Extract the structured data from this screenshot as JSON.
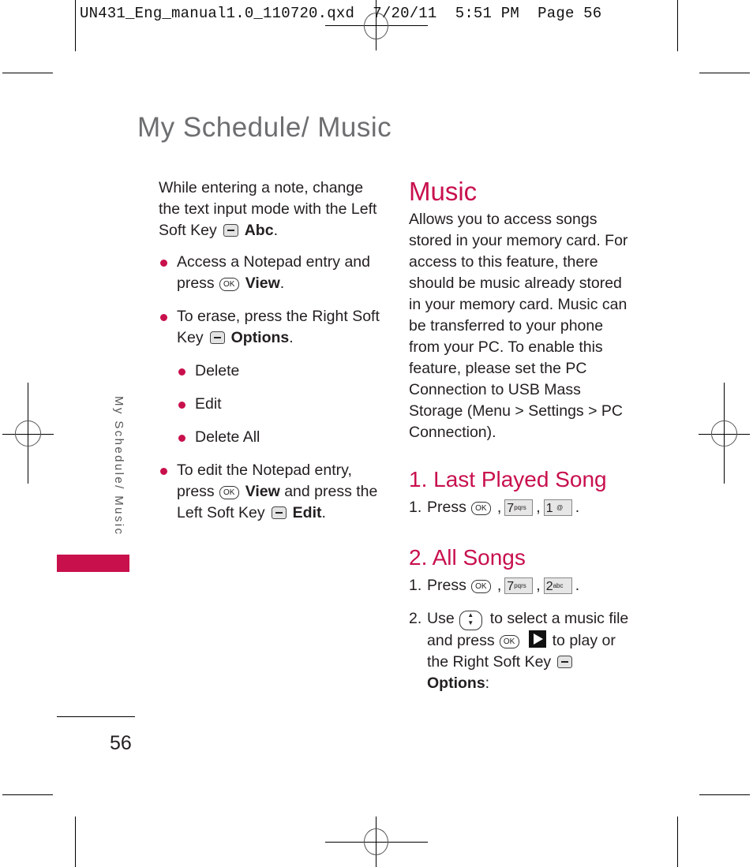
{
  "slug": {
    "filename": "UN431_Eng_manual1.0_110720.qxd",
    "date": "7/20/11",
    "time": "5:51 PM",
    "page_label": "Page 56"
  },
  "page_title": "My Schedule/ Music",
  "side_tab": {
    "label": "My Schedule/ Music",
    "accent_color": "#c8104c"
  },
  "folio": "56",
  "left_column": {
    "intro": {
      "text": "While entering a note, change the text input mode with the Left Soft Key",
      "key_icon": "soft-key-icon",
      "action": "Abc",
      "end": "."
    },
    "bullets": [
      {
        "text": "Access a Notepad entry and press",
        "key_icon": "ok-key-icon",
        "action": "View",
        "end": "."
      },
      {
        "text": "To erase, press the Right Soft Key",
        "key_icon": "soft-key-icon",
        "action": "Options",
        "end": "."
      }
    ],
    "sub_bullets": [
      "Delete",
      "Edit",
      "Delete All"
    ],
    "last_bullet": {
      "text1": "To edit the Notepad entry, press",
      "key1": "ok-key-icon",
      "action1": "View",
      "text2": "and press the Left Soft Key",
      "key2": "soft-key-icon",
      "action2": "Edit",
      "end": "."
    }
  },
  "right_column": {
    "heading": "Music",
    "description": "Allows you to access songs stored in your memory card. For access to this feature, there should be music already stored in your memory card. Music can be transferred to your phone from your PC. To enable this feature, please set the PC Connection to USB Mass Storage (Menu > Settings > PC Connection).",
    "sections": [
      {
        "heading": "1. Last Played Song",
        "steps": [
          {
            "num": "1.",
            "text": "Press",
            "keys": [
              {
                "icon": "ok-key-icon",
                "label": "OK"
              },
              {
                "icon": "key-7-icon",
                "digit": "7",
                "letters": "pqrs"
              },
              {
                "icon": "key-1-icon",
                "digit": "1",
                "letters": "@"
              }
            ]
          }
        ]
      },
      {
        "heading": "2. All Songs",
        "steps": [
          {
            "num": "1.",
            "text": "Press",
            "keys": [
              {
                "icon": "ok-key-icon",
                "label": "OK"
              },
              {
                "icon": "key-7-icon",
                "digit": "7",
                "letters": "pqrs"
              },
              {
                "icon": "key-2-icon",
                "digit": "2",
                "letters": "abc"
              }
            ]
          },
          {
            "num": "2.",
            "text_a": "Use",
            "nav_icon": "nav-up-down-key-icon",
            "text_b": "to select a music file and press",
            "play_icon": "play-icon",
            "text_c": "to play or the Right Soft Key",
            "action": "Options",
            "end": ":"
          }
        ]
      }
    ]
  },
  "colors": {
    "accent": "#c8104c",
    "title_gray": "#6d6e70",
    "body_text": "#231f20"
  }
}
